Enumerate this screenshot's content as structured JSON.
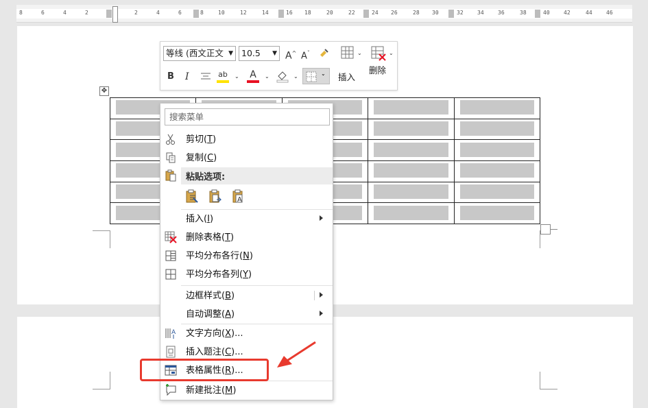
{
  "ruler": {
    "ticks": [
      "8",
      "6",
      "4",
      "2",
      "2",
      "4",
      "6",
      "8",
      "10",
      "12",
      "14",
      "16",
      "18",
      "20",
      "22",
      "24",
      "26",
      "28",
      "30",
      "32",
      "34",
      "36",
      "38",
      "40",
      "42",
      "44",
      "46"
    ]
  },
  "mini_toolbar": {
    "font_name": "等线 (西文正文",
    "font_size": "10.5",
    "grow_font": "A",
    "shrink_font": "A",
    "bold": "B",
    "italic": "I",
    "highlight_text": "ab",
    "font_color_text": "A",
    "insert_label": "插入",
    "delete_label": "删除"
  },
  "context_menu": {
    "search_placeholder": "搜索菜单",
    "items": [
      {
        "label": "剪切",
        "key": "T",
        "icon": "scissors-icon"
      },
      {
        "label": "复制",
        "key": "C",
        "icon": "copy-icon"
      },
      {
        "label": "插入",
        "key": "I",
        "icon": "",
        "submenu": true
      },
      {
        "label": "删除表格",
        "key": "T",
        "icon": "delete-table-icon"
      },
      {
        "label": "平均分布各行",
        "key": "N",
        "icon": "distribute-rows-icon"
      },
      {
        "label": "平均分布各列",
        "key": "Y",
        "icon": "distribute-columns-icon"
      },
      {
        "label": "边框样式",
        "key": "B",
        "icon": "",
        "submenu": true
      },
      {
        "label": "自动调整",
        "key": "A",
        "icon": "",
        "submenu": true
      },
      {
        "label": "文字方向",
        "key": "X",
        "suffix": "...",
        "icon": "text-direction-icon"
      },
      {
        "label": "插入题注",
        "key": "C",
        "suffix": "...",
        "icon": "insert-caption-icon"
      },
      {
        "label": "表格属性",
        "key": "R",
        "suffix": "...",
        "icon": "table-properties-icon"
      },
      {
        "label": "新建批注",
        "key": "M",
        "icon": "new-comment-icon"
      }
    ],
    "paste_header": "粘贴选项:"
  },
  "colors": {
    "highlight_red": "#e83a2e",
    "cell_gray": "#c8c8c8",
    "font_color_red": "#e81123",
    "highlight_yellow": "#ffe200"
  }
}
